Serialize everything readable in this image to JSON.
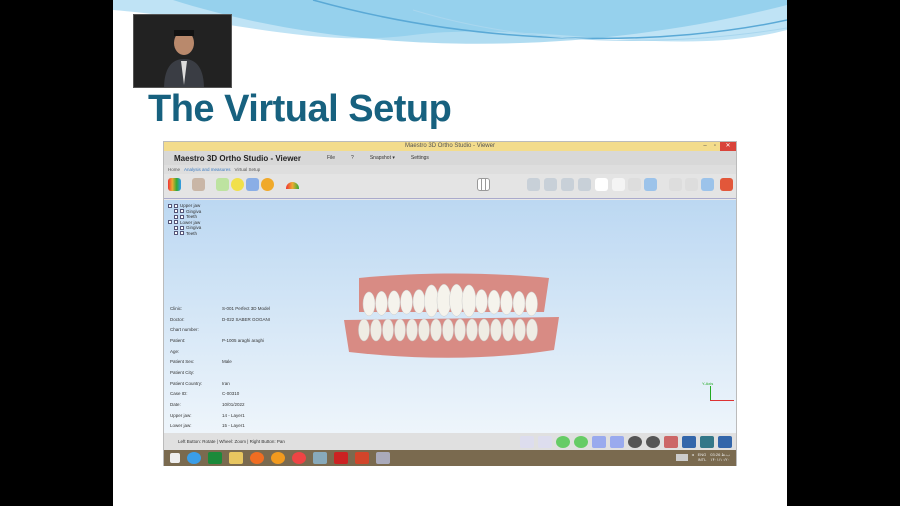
{
  "slide": {
    "title": "The Virtual Setup"
  },
  "window": {
    "title": "Maestro 3D Ortho Studio - Viewer",
    "app_name": "Maestro 3D Ortho Studio - Viewer",
    "menu": [
      "File",
      "?",
      "Snapshot ▾",
      "Settings"
    ],
    "tabs": [
      "Home",
      "Analysis and measures",
      "Virtual Setup"
    ],
    "tree": [
      {
        "label": "Upper jaw",
        "level": 0
      },
      {
        "label": "Gingiva",
        "level": 1
      },
      {
        "label": "Teeth",
        "level": 1
      },
      {
        "label": "Lower jaw",
        "level": 0
      },
      {
        "label": "Gingiva",
        "level": 1
      },
      {
        "label": "Teeth",
        "level": 1
      }
    ],
    "info": [
      {
        "k": "Clinic:",
        "v": "S-001 Perfect 3D Model"
      },
      {
        "k": "Doctor:",
        "v": "D-022 SABER GOGANI"
      },
      {
        "k": "Chart number:",
        "v": ""
      },
      {
        "k": "Patient:",
        "v": "P-1005 araghi araghi"
      },
      {
        "k": "Age:",
        "v": ""
      },
      {
        "k": "Patient Sex:",
        "v": "Male"
      },
      {
        "k": "Patient City:",
        "v": ""
      },
      {
        "k": "Patient Country:",
        "v": "Iran"
      },
      {
        "k": "Case ID:",
        "v": "C-00310"
      },
      {
        "k": "Date:",
        "v": "10/01/2022"
      },
      {
        "k": "Upper jaw:",
        "v": "14 - Layer1"
      },
      {
        "k": "Lower jaw:",
        "v": "15 - Layer1"
      }
    ],
    "axis_label": "Y-Axis",
    "status": "Left Button: Rotate | Wheel: Zoom | Right Button: Pan",
    "tray": {
      "lang": "ENG",
      "layout": "INTL",
      "time": "03:26 ب.ظ",
      "date": "۱۴۰۱/۱۰/۲۰"
    }
  },
  "colors": {
    "title": "#17617f",
    "titlebar": "#f3dc8c",
    "gum": "#d88b84",
    "taskbar": "#7a6a4f"
  }
}
